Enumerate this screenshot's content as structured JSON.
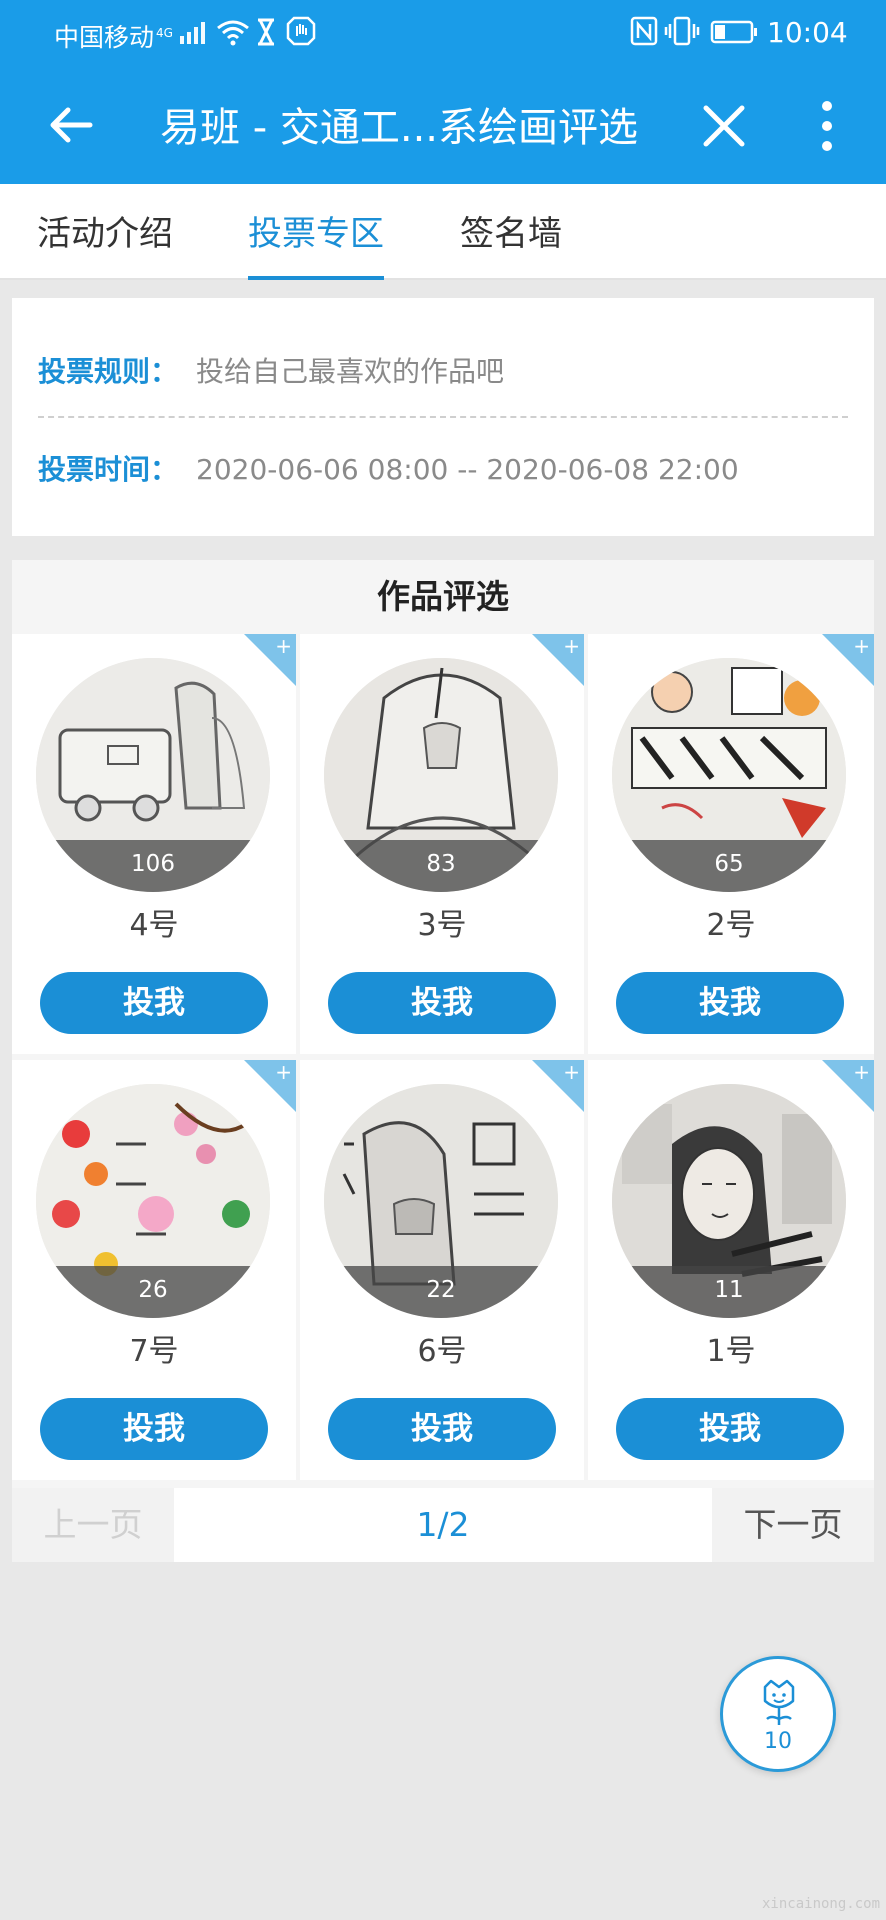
{
  "status_bar": {
    "carrier": "中国移动",
    "network": "4G",
    "time": "10:04"
  },
  "title_bar": {
    "title": "易班 - 交通工...系绘画评选"
  },
  "tabs": [
    {
      "label": "活动介绍",
      "active": false
    },
    {
      "label": "投票专区",
      "active": true
    },
    {
      "label": "签名墙",
      "active": false
    }
  ],
  "rules": {
    "rule_label": "投票规则：",
    "rule_value": "投给自己最喜欢的作品吧",
    "time_label": "投票时间：",
    "time_value": "2020-06-06 08:00 -- 2020-06-08 22:00"
  },
  "works": {
    "title": "作品评选",
    "vote_label": "投我",
    "corner_label": "+",
    "items": [
      {
        "number": "4号",
        "likes": "106"
      },
      {
        "number": "3号",
        "likes": "83"
      },
      {
        "number": "2号",
        "likes": "65"
      },
      {
        "number": "7号",
        "likes": "26"
      },
      {
        "number": "6号",
        "likes": "22"
      },
      {
        "number": "1号",
        "likes": "11"
      }
    ]
  },
  "pagination": {
    "prev": "上一页",
    "info": "1/2",
    "next": "下一页"
  },
  "fab": {
    "count": "10"
  },
  "watermark": "xincainong.com",
  "colors": {
    "primary": "#1a9ce8",
    "accent": "#1b8fd6",
    "corner": "#7ec3ea"
  }
}
